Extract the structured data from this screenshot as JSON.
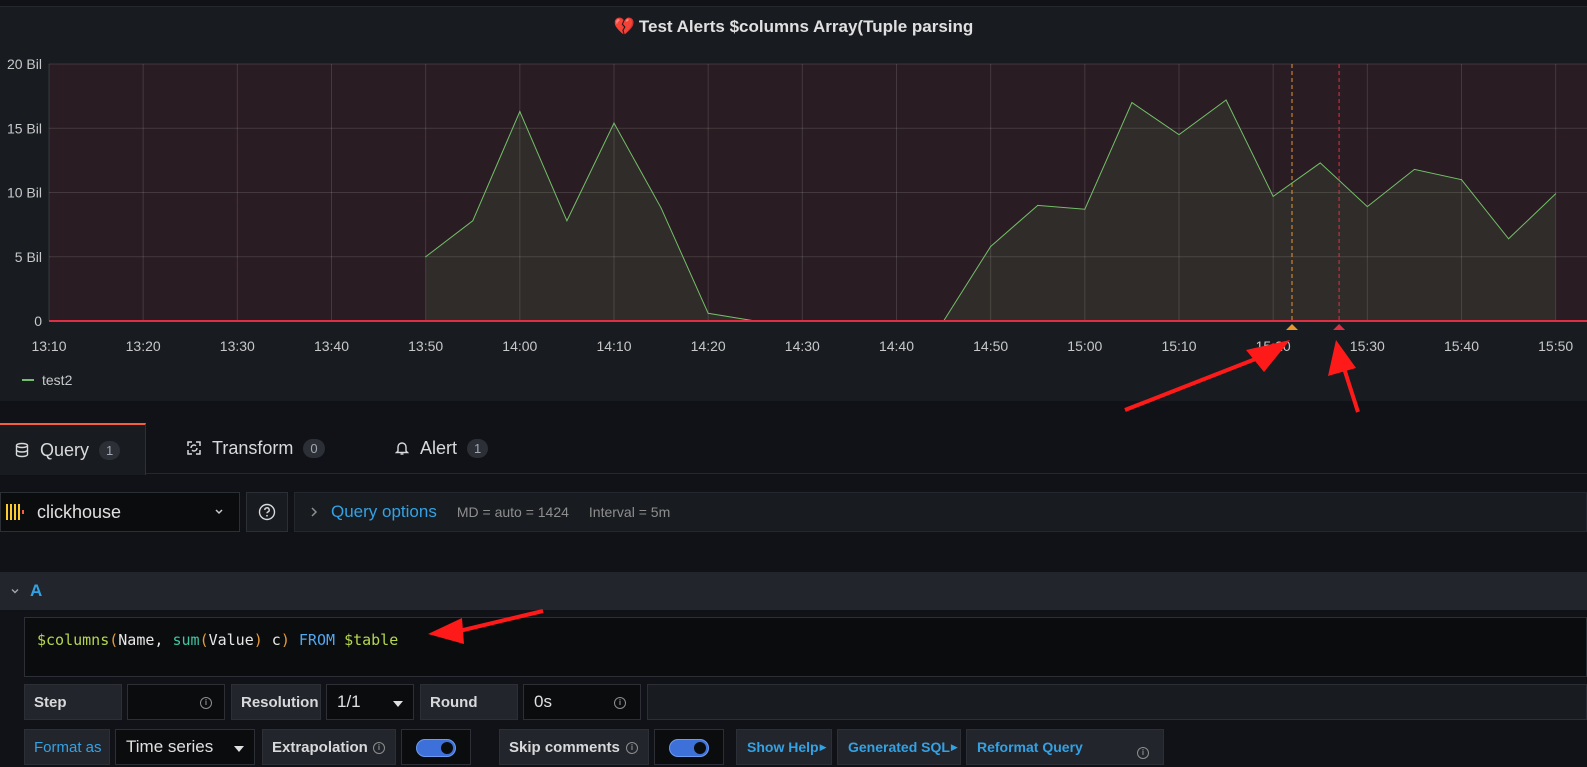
{
  "panel": {
    "title": "Test Alerts $columns Array(Tuple parsing",
    "title_icon": "broken-heart-icon",
    "legend": [
      {
        "name": "test2",
        "color": "#73bf69"
      }
    ]
  },
  "chart_data": {
    "type": "area",
    "title": "Test Alerts $columns Array(Tuple parsing",
    "xlabel": "",
    "ylabel": "",
    "y_unit_suffix": " Bil",
    "x_ticks": [
      "13:10",
      "13:20",
      "13:30",
      "13:40",
      "13:50",
      "14:00",
      "14:10",
      "14:20",
      "14:30",
      "14:40",
      "14:50",
      "15:00",
      "15:10",
      "15:20",
      "15:30",
      "15:40",
      "15:50"
    ],
    "y_ticks": [
      "0",
      "5 Bil",
      "10 Bil",
      "15 Bil",
      "20 Bil"
    ],
    "ylim": [
      0,
      20
    ],
    "xlim": [
      "13:10",
      "15:50"
    ],
    "threshold": {
      "value": 0,
      "color": "#e02f44",
      "fill": "above"
    },
    "series": [
      {
        "name": "test2",
        "color": "#73bf69",
        "x": [
          "13:50",
          "13:55",
          "14:00",
          "14:05",
          "14:10",
          "14:15",
          "14:20",
          "14:25",
          "14:30",
          "14:35",
          "14:40",
          "14:45",
          "14:50",
          "14:55",
          "15:00",
          "15:05",
          "15:10",
          "15:15",
          "15:20",
          "15:25",
          "15:30",
          "15:35",
          "15:40",
          "15:45",
          "15:50"
        ],
        "values": [
          5.0,
          7.8,
          16.3,
          7.8,
          15.4,
          8.8,
          0.6,
          0.0,
          0.0,
          0.0,
          0.0,
          0.0,
          5.8,
          9.0,
          8.7,
          17.0,
          14.5,
          17.2,
          9.7,
          12.3,
          8.9,
          11.8,
          11.0,
          6.4,
          9.9
        ]
      }
    ],
    "annotations": [
      {
        "time": "15:22",
        "color": "#e8962e",
        "style": "dashed"
      },
      {
        "time": "15:27",
        "color": "#e02f44",
        "style": "dashed"
      }
    ],
    "grid": true,
    "legend_position": "bottom-left"
  },
  "tabs": [
    {
      "label": "Query",
      "count": "1",
      "icon": "database-icon"
    },
    {
      "label": "Transform",
      "count": "0",
      "icon": "transform-icon"
    },
    {
      "label": "Alert",
      "count": "1",
      "icon": "bell-icon"
    }
  ],
  "datasource": {
    "name": "clickhouse",
    "icon": "clickhouse-logo-icon"
  },
  "query_options": {
    "label": "Query options",
    "md": "MD = auto = 1424",
    "interval": "Interval = 5m"
  },
  "query": {
    "ref_id": "A",
    "tokens": [
      {
        "t": "$columns",
        "c": "tk-var"
      },
      {
        "t": "(",
        "c": "tk-paren"
      },
      {
        "t": "Name, ",
        "c": "tk-id"
      },
      {
        "t": "sum",
        "c": "tk-fn"
      },
      {
        "t": "(",
        "c": "tk-paren"
      },
      {
        "t": "Value",
        "c": "tk-id"
      },
      {
        "t": ")",
        "c": "tk-paren"
      },
      {
        "t": " c",
        "c": "tk-id"
      },
      {
        "t": ")",
        "c": "tk-paren"
      },
      {
        "t": " FROM ",
        "c": "tk-kw"
      },
      {
        "t": "$table",
        "c": "tk-var"
      }
    ]
  },
  "fields": {
    "step_label": "Step",
    "step_value": "",
    "resolution_label": "Resolution",
    "resolution_value": "1/1",
    "round_label": "Round",
    "round_value": "0s",
    "format_label": "Format as",
    "format_value": "Time series",
    "extrapolation_label": "Extrapolation",
    "extrapolation_on": true,
    "skip_comments_label": "Skip comments",
    "skip_comments_on": true,
    "show_help_label": "Show Help",
    "generated_sql_label": "Generated SQL",
    "reformat_label": "Reformat Query"
  }
}
